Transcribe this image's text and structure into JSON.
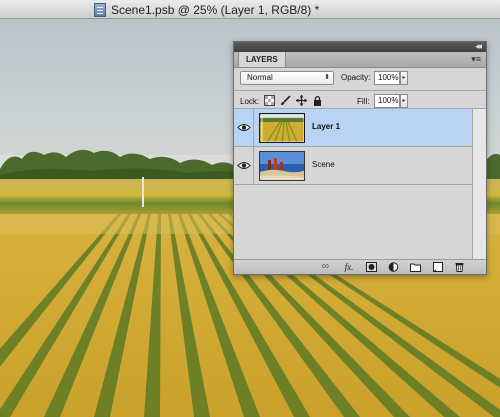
{
  "window": {
    "title": "Scene1.psb @ 25% (Layer 1, RGB/8) *",
    "doc_icon": "document-icon"
  },
  "layers_panel": {
    "tab_label": "LAYERS",
    "collapse_glyph": "◂◂",
    "menu_glyph": "▾≡",
    "blend_mode": "Normal",
    "opacity_label": "Opacity:",
    "opacity_value": "100%",
    "lock_label": "Lock:",
    "fill_label": "Fill:",
    "fill_value": "100%",
    "lock_icons": [
      "lock-transparent-icon",
      "lock-paint-icon",
      "lock-move-icon",
      "lock-all-icon"
    ],
    "layers": [
      {
        "name": "Layer 1",
        "visible": true,
        "selected": true
      },
      {
        "name": "Scene",
        "visible": true,
        "selected": false
      }
    ],
    "footer_icons": [
      "link-icon",
      "fx-icon",
      "mask-icon",
      "adjustment-icon",
      "group-icon",
      "new-layer-icon",
      "trash-icon"
    ],
    "footer_glyphs": {
      "link": "∞",
      "fx": "fx."
    }
  },
  "colors": {
    "selection": "#b8d3f4",
    "panel_bg": "#d6d6d6",
    "panel_header": "#3e3e3e"
  }
}
